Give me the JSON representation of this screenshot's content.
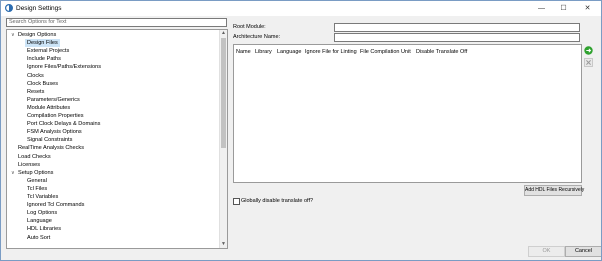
{
  "window": {
    "title": "Design Settings"
  },
  "search": {
    "placeholder": "Search Options for Text"
  },
  "tree": [
    {
      "label": "Design Options",
      "expanded": true
    },
    {
      "label": "Design Files",
      "selected": true
    },
    {
      "label": "External Projects"
    },
    {
      "label": "Include Paths"
    },
    {
      "label": "Ignore Files/Paths/Extensions"
    },
    {
      "label": "Clocks"
    },
    {
      "label": "Clock Buses"
    },
    {
      "label": "Resets"
    },
    {
      "label": "Parameters/Generics"
    },
    {
      "label": "Module Attributes"
    },
    {
      "label": "Compilation Properties"
    },
    {
      "label": "Port Clock Delays & Domains"
    },
    {
      "label": "FSM Analysis Options"
    },
    {
      "label": "Signal Constraints"
    },
    {
      "label": "RealTime Analysis Checks"
    },
    {
      "label": "Load Checks"
    },
    {
      "label": "Licenses"
    },
    {
      "label": "Setup Options",
      "expanded": true
    },
    {
      "label": "General"
    },
    {
      "label": "Tcl Files"
    },
    {
      "label": "Tcl Variables"
    },
    {
      "label": "Ignored Tcl Commands"
    },
    {
      "label": "Log Options"
    },
    {
      "label": "Language"
    },
    {
      "label": "HDL Libraries"
    },
    {
      "label": "Auto Sort"
    }
  ],
  "form": {
    "root_module_label": "Root Module:",
    "root_module_value": "",
    "architecture_label": "Architecture Name:",
    "architecture_value": ""
  },
  "files_table": {
    "columns": [
      "Name",
      "Library",
      "Language",
      "Ignore File for Linting",
      "File Compilation Unit",
      "Disable Translate Off"
    ],
    "rows": []
  },
  "buttons": {
    "add_hdl": "Add HDL Files Recursively",
    "ok": "OK",
    "cancel": "Cancel"
  },
  "checkbox": {
    "label": "Globally disable translate off?",
    "checked": false
  },
  "colors": {
    "accent": "#2ea12e",
    "selection": "#cce4f7"
  }
}
